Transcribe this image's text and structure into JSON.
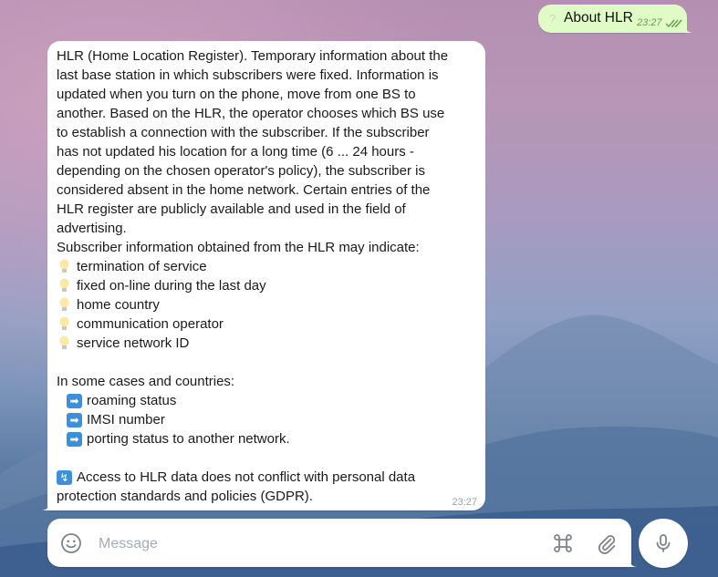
{
  "outgoing": {
    "icon": "question-mark-icon",
    "text": "About HLR",
    "time": "23:27",
    "status": "read"
  },
  "incoming": {
    "paragraph_lines": [
      "HLR (Home Location Register). Temporary information about the",
      "last base station in which subscribers were fixed. Information is",
      "updated when you turn on the phone, move from one BS to",
      "another. Based on the HLR, the operator chooses which BS use",
      "to establish a connection with the subscriber. If the subscriber",
      "has not updated his location for a long time (6 ... 24 hours -",
      "depending on the chosen operator's policy), the subscriber is",
      "considered absent in the home network. Certain entries of the",
      "HLR register are publicly available and used in the field of",
      "advertising."
    ],
    "indicate_intro": "Subscriber information obtained from the HLR may indicate:",
    "indicate_items": [
      "termination of service",
      "fixed on-line during the last day",
      "home country",
      "communication operator",
      "service network ID"
    ],
    "cases_intro": "In some cases and countries:",
    "cases_items": [
      "roaming status",
      "IMSI number",
      "porting status to another network."
    ],
    "arrow_glyph": "➡",
    "gdpr_glyph": "↯",
    "gdpr_lines": [
      "Access to HLR data does not conflict with personal data",
      "protection standards and policies (GDPR)."
    ],
    "time": "23:27"
  },
  "composer": {
    "placeholder": "Message",
    "icons": [
      "smile-icon",
      "command-icon",
      "paperclip-icon",
      "microphone-icon"
    ]
  },
  "colors": {
    "outgoing_bubble": "#e1fbc7",
    "incoming_bubble": "#ffffff",
    "read_check": "#5aa34b",
    "icon_gray": "#7d848b"
  }
}
